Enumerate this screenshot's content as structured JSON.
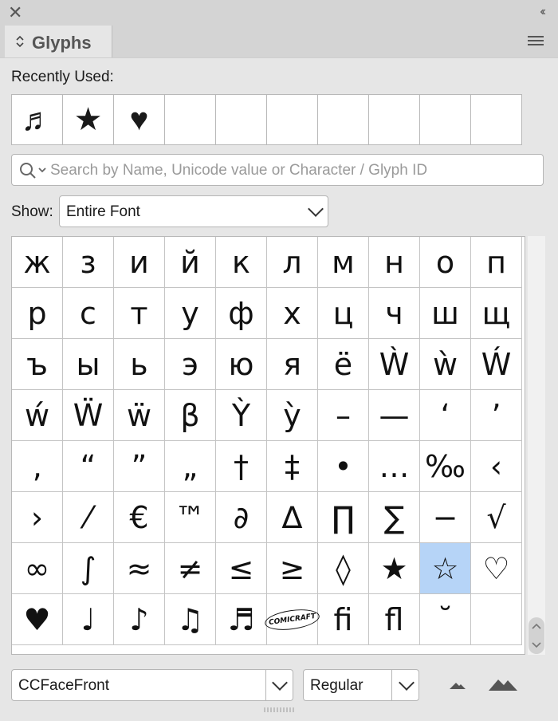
{
  "panel": {
    "close_glyph": "✕",
    "collapse_glyph": "‹‹",
    "tab_title": "Glyphs",
    "tab_arrows": "⌃⌄"
  },
  "recently_used": {
    "label": "Recently Used:",
    "items": [
      "♬",
      "★",
      "♥",
      "",
      "",
      "",
      "",
      "",
      "",
      ""
    ]
  },
  "search": {
    "placeholder": "Search by Name, Unicode value or Character / Glyph ID",
    "value": ""
  },
  "show": {
    "label": "Show:",
    "value": "Entire Font"
  },
  "glyph_grid": {
    "selected_index": 68,
    "cells": [
      "ж",
      "з",
      "и",
      "й",
      "к",
      "л",
      "м",
      "н",
      "о",
      "п",
      "р",
      "с",
      "т",
      "у",
      "ф",
      "х",
      "ц",
      "ч",
      "ш",
      "щ",
      "ъ",
      "ы",
      "ь",
      "э",
      "ю",
      "я",
      "ё",
      "Ẁ",
      "ẁ",
      "Ẃ",
      "ẃ",
      "Ẅ",
      "ẅ",
      "β",
      "Ỳ",
      "ỳ",
      "–",
      "—",
      "‘",
      "’",
      "‚",
      "“",
      "”",
      "„",
      "†",
      "‡",
      "•",
      "…",
      "‰",
      "‹",
      "›",
      "⁄",
      "€",
      "™",
      "∂",
      "∆",
      "∏",
      "∑",
      "−",
      "√",
      "∞",
      "∫",
      "≈",
      "≠",
      "≤",
      "≥",
      "◊",
      "★",
      "☆",
      "♡",
      "♥",
      "♩",
      "♪",
      "♫",
      "♬",
      "COMICRAFT",
      "ﬁ",
      "ﬂ",
      "˘",
      ""
    ]
  },
  "footer": {
    "font_family": "CCFaceFront",
    "font_style": "Regular"
  },
  "icons": {
    "close": "close-icon",
    "collapse": "double-chevron-left-icon",
    "menu": "hamburger-menu-icon",
    "search": "search-icon",
    "zoom_out": "small-mountain-icon",
    "zoom_in": "large-mountain-icon"
  },
  "colors": {
    "selection": "#b6d4f7",
    "panel_bg": "#e6e6e6"
  }
}
